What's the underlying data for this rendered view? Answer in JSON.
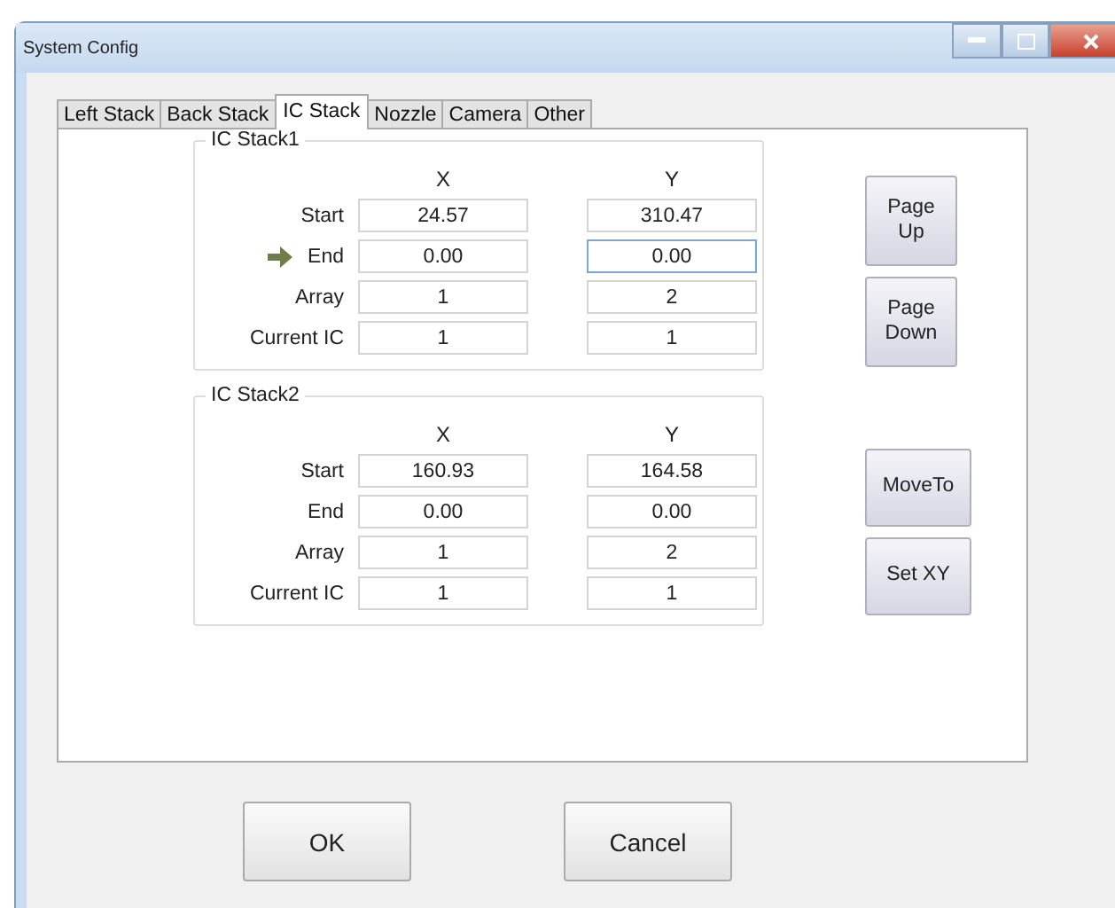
{
  "window": {
    "title": "System Config"
  },
  "tabs": [
    {
      "label": "Left Stack",
      "selected": false
    },
    {
      "label": "Back Stack",
      "selected": false
    },
    {
      "label": "IC Stack",
      "selected": true
    },
    {
      "label": "Nozzle",
      "selected": false
    },
    {
      "label": "Camera",
      "selected": false
    },
    {
      "label": "Other",
      "selected": false
    }
  ],
  "groups": [
    {
      "title": "IC Stack1",
      "columns": [
        "X",
        "Y"
      ],
      "rows": [
        {
          "label": "Start",
          "pointer": false,
          "fields": [
            {
              "value": "24.57",
              "focused": false
            },
            {
              "value": "310.47",
              "focused": false
            }
          ]
        },
        {
          "label": "End",
          "pointer": true,
          "fields": [
            {
              "value": "0.00",
              "focused": false
            },
            {
              "value": "0.00",
              "focused": true
            }
          ]
        },
        {
          "label": "Array",
          "pointer": false,
          "fields": [
            {
              "value": "1",
              "focused": false
            },
            {
              "value": "2",
              "focused": false
            }
          ]
        },
        {
          "label": "Current IC",
          "pointer": false,
          "fields": [
            {
              "value": "1",
              "focused": false
            },
            {
              "value": "1",
              "focused": false
            }
          ]
        }
      ],
      "buttons": [
        "Page Up",
        "Page Down"
      ]
    },
    {
      "title": "IC Stack2",
      "columns": [
        "X",
        "Y"
      ],
      "rows": [
        {
          "label": "Start",
          "pointer": false,
          "fields": [
            {
              "value": "160.93",
              "focused": false
            },
            {
              "value": "164.58",
              "focused": false
            }
          ]
        },
        {
          "label": "End",
          "pointer": false,
          "fields": [
            {
              "value": "0.00",
              "focused": false
            },
            {
              "value": "0.00",
              "focused": false
            }
          ]
        },
        {
          "label": "Array",
          "pointer": false,
          "fields": [
            {
              "value": "1",
              "focused": false
            },
            {
              "value": "2",
              "focused": false
            }
          ]
        },
        {
          "label": "Current IC",
          "pointer": false,
          "fields": [
            {
              "value": "1",
              "focused": false
            },
            {
              "value": "1",
              "focused": false
            }
          ]
        }
      ],
      "buttons": [
        "MoveTo",
        "Set XY"
      ]
    }
  ],
  "buttons": [
    "OK",
    "Cancel"
  ]
}
